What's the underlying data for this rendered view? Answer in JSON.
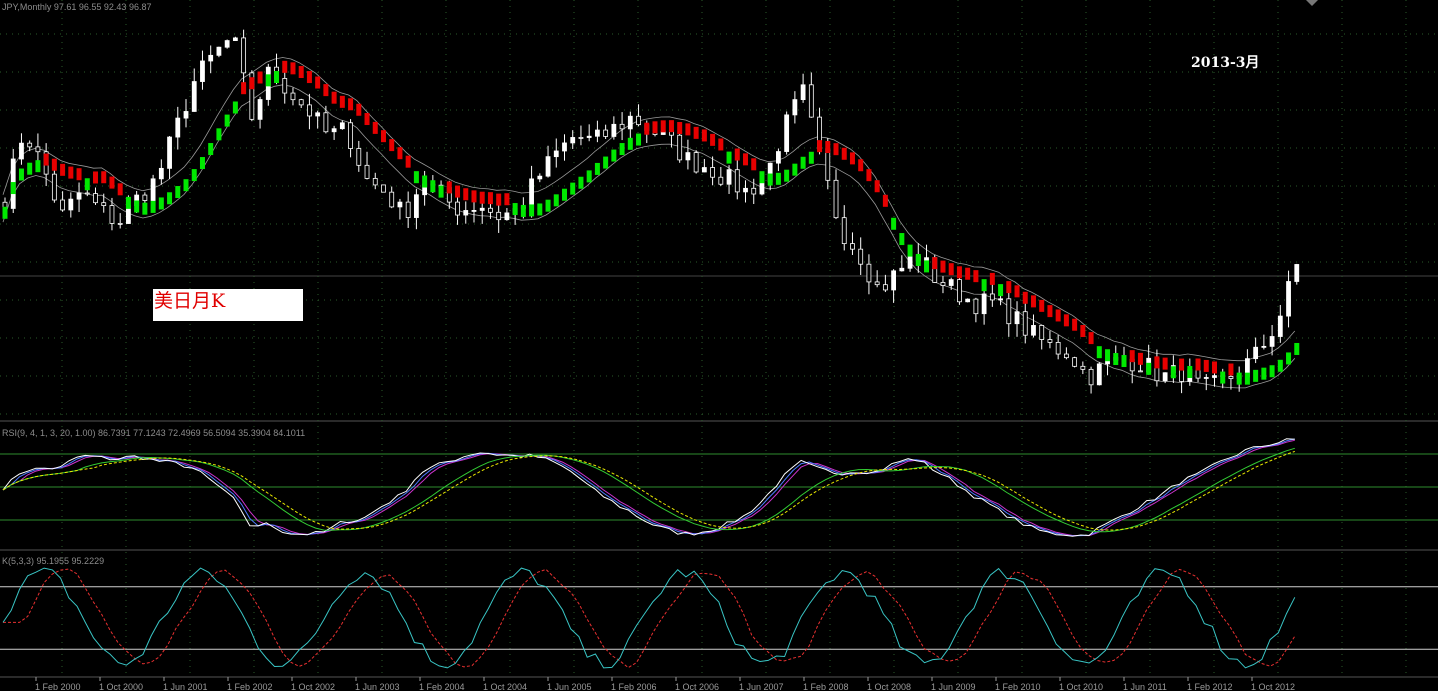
{
  "header": {
    "symbol_label": "JPY,Monthly",
    "ohlc_text": "97.61 96.55 92.43 96.87"
  },
  "annotations": {
    "date_label": "2013-3月",
    "box_label": "美日月K"
  },
  "indicators": {
    "rsi_label": "RSI(9, 4, 1, 3, 20, 1.00) 86.7391 77.1243 72.4969 56.5094 35.3904 84.1011",
    "stoch_label": "K(5,3,3) 95.1955 95.2229"
  },
  "colors": {
    "background": "#000000",
    "grid": "#2a5a2a",
    "bull_candle": "#ffffff",
    "bear_candle": "#ffffff",
    "up_marker": "#00e800",
    "down_marker": "#e80000",
    "ma_line": "#9a9a9a",
    "rsi_white": "#ffffff",
    "rsi_blue": "#4d79ff",
    "rsi_magenta": "#cc33cc",
    "rsi_yellow": "#e8e800",
    "rsi_green": "#33cc33",
    "stoch_main": "#39c5c5",
    "stoch_signal": "#e83030",
    "level_line": "#2e8b2e",
    "stoch_level": "#d0d0d0"
  },
  "chart_data": [
    {
      "type": "candlestick",
      "title": "JPY,Monthly",
      "x_ticks": [
        "1 Feb 2000",
        "1 Oct 2000",
        "1 Jun 2001",
        "1 Feb 2002",
        "1 Oct 2002",
        "1 Jun 2003",
        "1 Feb 2004",
        "1 Oct 2004",
        "1 Jun 2005",
        "1 Feb 2006",
        "1 Oct 2006",
        "1 Jun 2007",
        "1 Feb 2008",
        "1 Oct 2008",
        "1 Jun 2009",
        "1 Feb 2010",
        "1 Oct 2010",
        "1 Jun 2011",
        "1 Feb 2012",
        "1 Oct 2012"
      ],
      "close_path": [
        107,
        118,
        112,
        104,
        108,
        105,
        103,
        107,
        110,
        118,
        126,
        130,
        133,
        120,
        128,
        124,
        121,
        117,
        118,
        110,
        108,
        104,
        110,
        107,
        105,
        106,
        104,
        105,
        110,
        114,
        117,
        116,
        118,
        120,
        118,
        116,
        113,
        112,
        110,
        108,
        110,
        118,
        124,
        112,
        102,
        98,
        92,
        95,
        98,
        94,
        92,
        90,
        90,
        88,
        85,
        83,
        82,
        78,
        80,
        81,
        80,
        78,
        79,
        76,
        77,
        79,
        82,
        87,
        96
      ],
      "grid": true
    },
    {
      "type": "line",
      "title": "RSI",
      "levels": [
        80,
        50,
        20
      ]
    },
    {
      "type": "line",
      "title": "Stochastic",
      "levels": [
        80,
        20
      ]
    }
  ]
}
